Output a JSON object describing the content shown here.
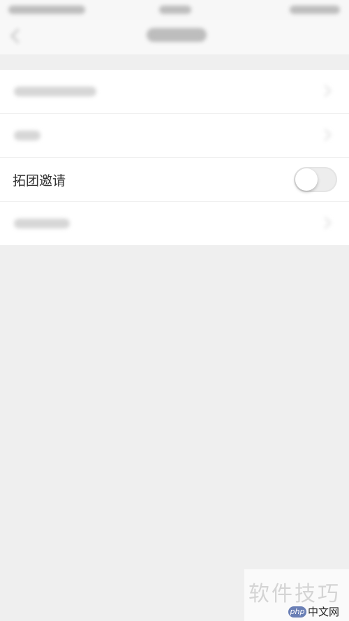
{
  "settings": {
    "rows": [
      {
        "id": "row-1",
        "label": ""
      },
      {
        "id": "row-2",
        "label": ""
      },
      {
        "id": "row-3",
        "label": "拓团邀请",
        "toggle_on": false
      },
      {
        "id": "row-4",
        "label": ""
      }
    ]
  },
  "watermark": {
    "title": "软件技巧",
    "logo_badge": "php",
    "logo_site": "中文网"
  },
  "colors": {
    "background": "#efefef",
    "row_background": "#ffffff",
    "text_primary": "#333333",
    "toggle_off": "#ededed",
    "php_badge": "#6a7fb5"
  },
  "icons": {
    "back": "chevron-left-icon",
    "row_arrow": "chevron-right-icon"
  }
}
